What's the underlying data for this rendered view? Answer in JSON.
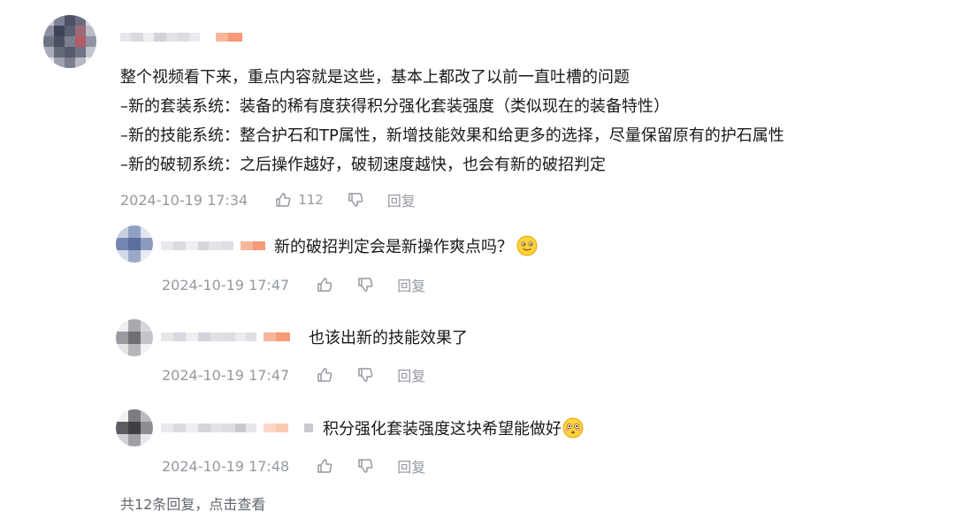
{
  "main_comment": {
    "lines": [
      "整个视频看下来，重点内容就是这些，基本上都改了以前一直吐槽的问题",
      "–新的套装系统：装备的稀有度获得积分强化套装强度（类似现在的装备特性）",
      "–新的技能系统：整合护石和TP属性，新增技能效果和给更多的选择，尽量保留原有的护石属性",
      "–新的破韧系统：之后操作越好，破韧速度越快，也会有新的破招判定"
    ],
    "time": "2024-10-19 17:34",
    "likes": "112",
    "reply_label": "回复"
  },
  "replies": [
    {
      "text": "新的破招判定会是新操作爽点吗？",
      "emoji": "slight-smile-emoji",
      "time": "2024-10-19 17:47",
      "reply_label": "回复"
    },
    {
      "text": "也该出新的技能效果了",
      "time": "2024-10-19 17:47",
      "reply_label": "回复"
    },
    {
      "text": "积分强化套装强度这块希望能做好",
      "emoji": "flushed-emoji",
      "time": "2024-10-19 17:48",
      "reply_label": "回复"
    }
  ],
  "more_replies": "共12条回复，点击查看",
  "colors": {
    "text": "#18191c",
    "meta": "#9499a0",
    "more": "#61666d",
    "level_badge": "#f69a78"
  }
}
